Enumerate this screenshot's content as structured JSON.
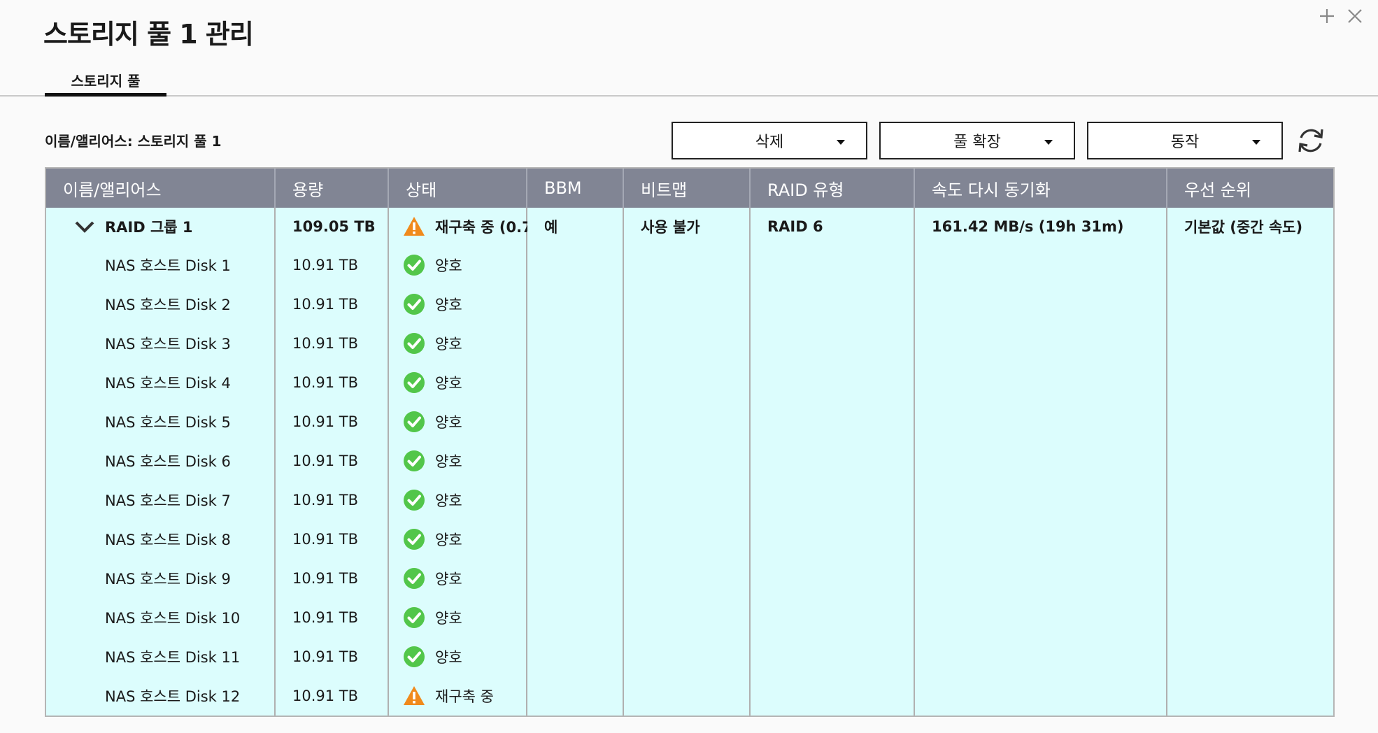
{
  "window": {
    "title": "스토리지 풀 1 관리"
  },
  "tabs": [
    {
      "label": "스토리지 풀"
    }
  ],
  "alias": {
    "label": "이름/앨리어스: 스토리지 풀 1"
  },
  "toolbar": {
    "delete_label": "삭제",
    "expand_label": "풀 확장",
    "action_label": "동작"
  },
  "table": {
    "columns": [
      "이름/앨리어스",
      "용량",
      "상태",
      "BBM",
      "비트맵",
      "RAID 유형",
      "속도 다시 동기화",
      "우선 순위"
    ],
    "group": {
      "name": "RAID 그룹 1",
      "capacity": "109.05 TB",
      "status": "재구축 중 (0.7",
      "bbm": "예",
      "bitmap": "사용 불가",
      "raid_type": "RAID 6",
      "resync_speed": "161.42 MB/s (19h 31m)",
      "priority": "기본값 (중간 속도)"
    },
    "disks": [
      {
        "name": "NAS 호스트 Disk 1",
        "capacity": "10.91 TB",
        "status": "양호",
        "state": "good"
      },
      {
        "name": "NAS 호스트 Disk 2",
        "capacity": "10.91 TB",
        "status": "양호",
        "state": "good"
      },
      {
        "name": "NAS 호스트 Disk 3",
        "capacity": "10.91 TB",
        "status": "양호",
        "state": "good"
      },
      {
        "name": "NAS 호스트 Disk 4",
        "capacity": "10.91 TB",
        "status": "양호",
        "state": "good"
      },
      {
        "name": "NAS 호스트 Disk 5",
        "capacity": "10.91 TB",
        "status": "양호",
        "state": "good"
      },
      {
        "name": "NAS 호스트 Disk 6",
        "capacity": "10.91 TB",
        "status": "양호",
        "state": "good"
      },
      {
        "name": "NAS 호스트 Disk 7",
        "capacity": "10.91 TB",
        "status": "양호",
        "state": "good"
      },
      {
        "name": "NAS 호스트 Disk 8",
        "capacity": "10.91 TB",
        "status": "양호",
        "state": "good"
      },
      {
        "name": "NAS 호스트 Disk 9",
        "capacity": "10.91 TB",
        "status": "양호",
        "state": "good"
      },
      {
        "name": "NAS 호스트 Disk 10",
        "capacity": "10.91 TB",
        "status": "양호",
        "state": "good"
      },
      {
        "name": "NAS 호스트 Disk 11",
        "capacity": "10.91 TB",
        "status": "양호",
        "state": "good"
      },
      {
        "name": "NAS 호스트 Disk 12",
        "capacity": "10.91 TB",
        "status": "재구축 중",
        "state": "warning"
      }
    ]
  },
  "colors": {
    "header_bg": "#818594",
    "row_bg": "#dcfdfd",
    "good": "#52c64a",
    "warning": "#f08a1c"
  },
  "icons": {
    "good": "check-circle-icon",
    "warning": "warning-triangle-icon",
    "expand": "chevron-down-icon",
    "refresh": "refresh-icon",
    "add": "plus-icon",
    "close": "close-icon"
  }
}
